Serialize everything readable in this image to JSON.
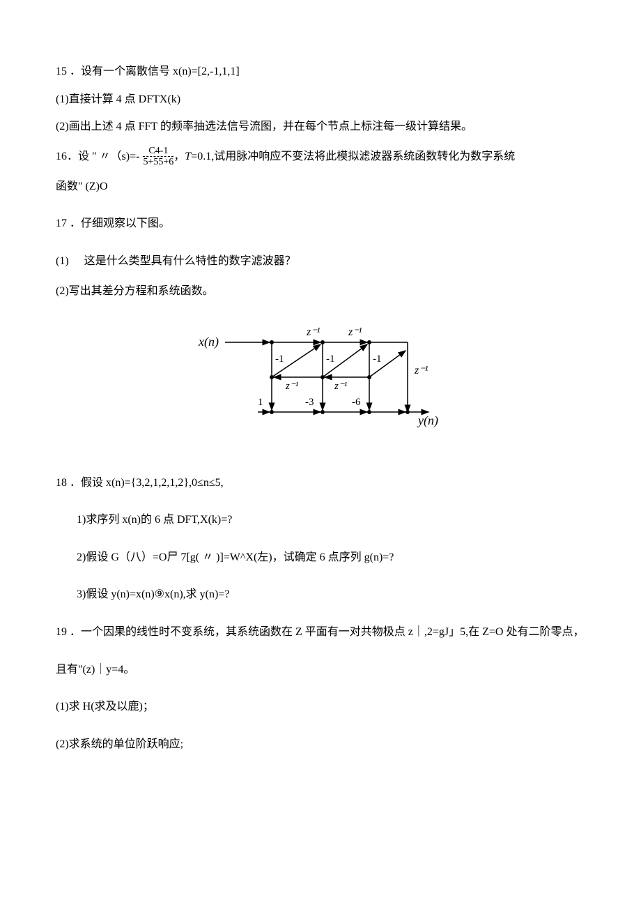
{
  "q15": {
    "num": "15",
    "title": "．设有一个离散信号 x(n)=[2,-1,1,1]",
    "p1": "(1)直接计算 4 点 DFTX(k)",
    "p2": "(2)画出上述 4 点 FFT 的频率抽选法信号流图，并在每个节点上标注每一级计算结果。"
  },
  "q16": {
    "num": "16",
    "pre": "．设 \" 〃（s)=-",
    "frac_top": "C4-1",
    "frac_bot": "5+55+6",
    "t_label": "T",
    "post": "=0.1,试用脉冲响应不变法将此模拟滤波器系统函数转化为数字系统",
    "p2": "函数\" (Z)O"
  },
  "q17": {
    "num": "17",
    "title": "．仔细观察以下图。",
    "p1_num": "(1)",
    "p1_txt": "这是什么类型具有什么特性的数字滤波器？",
    "p2": "(2)写出其差分方程和系统函数。"
  },
  "figure": {
    "xn": "x(n)",
    "yn": "y(n)",
    "zinv": "z⁻¹",
    "m1_a": "-1",
    "m1_b": "-1",
    "m1_c": "-1",
    "one": "1",
    "m3": "-3",
    "m6": "-6"
  },
  "q18": {
    "num": "18",
    "title": "．假设 x(n)={3,2,1,2,1,2},0≤n≤5,",
    "p1": "1)求序列 x(n)的 6 点 DFT,X(k)=?",
    "p2": "2)假设 G（八）=O尸 7[g( 〃 )]=W^X(左)，试确定 6 点序列 g(n)=?",
    "p3": "3)假设 y(n)=x(n)⑨x(n),求 y(n)=?"
  },
  "q19": {
    "num": "19",
    "p1": "．一个因果的线性时不变系统，其系统函数在 Z 平面有一对共物极点 z｜,2=gJ」5,在 Z=O 处有二阶零点，",
    "p2": "且有\"(z)｜y=4。",
    "p3": "(1)求 H(求及以鹿)；",
    "p4": "(2)求系统的单位阶跃响应;"
  }
}
